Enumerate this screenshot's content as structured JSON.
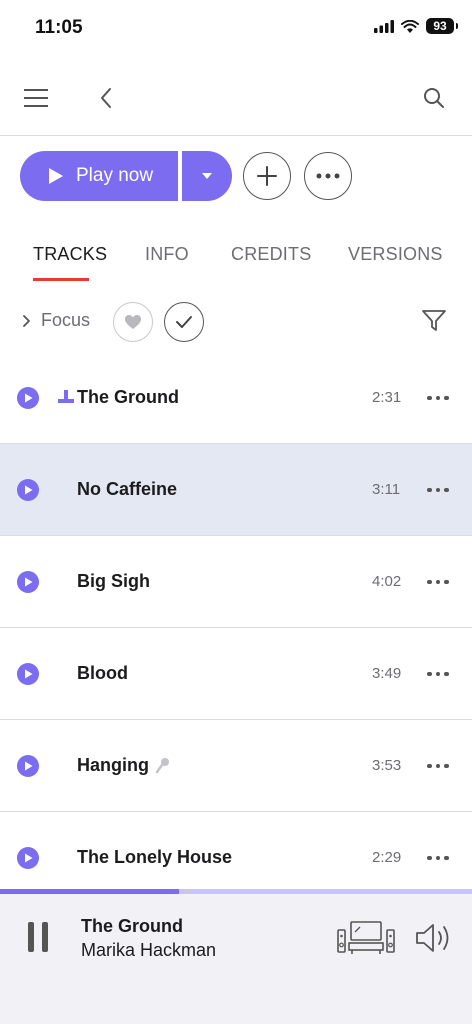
{
  "status_bar": {
    "time": "11:05",
    "battery": "93"
  },
  "nav": {
    "menu_icon": "hamburger-menu-icon",
    "back_icon": "chevron-left-icon",
    "search_icon": "search-icon"
  },
  "actions": {
    "play_label": "Play now",
    "add_icon": "plus-icon",
    "more_icon": "ellipsis-icon"
  },
  "tabs": [
    {
      "label": "TRACKS",
      "active": true
    },
    {
      "label": "INFO",
      "active": false
    },
    {
      "label": "CREDITS",
      "active": false
    },
    {
      "label": "VERSIONS",
      "active": false
    }
  ],
  "focus": {
    "label": "Focus"
  },
  "tracks": [
    {
      "title": "The Ground",
      "duration": "2:31",
      "highlighted": false,
      "now_playing": true
    },
    {
      "title": "No Caffeine",
      "duration": "3:11",
      "highlighted": true,
      "now_playing": false
    },
    {
      "title": "Big Sigh",
      "duration": "4:02",
      "highlighted": false,
      "now_playing": false
    },
    {
      "title": "Blood",
      "duration": "3:49",
      "highlighted": false,
      "now_playing": false
    },
    {
      "title": "Hanging",
      "duration": "3:53",
      "highlighted": false,
      "now_playing": false,
      "has_extra_icon": true
    },
    {
      "title": "The Lonely House",
      "duration": "2:29",
      "highlighted": false,
      "now_playing": false
    }
  ],
  "playback": {
    "progress": 0.38
  },
  "now_playing": {
    "title": "The Ground",
    "artist": "Marika Hackman"
  },
  "colors": {
    "accent": "#7b6cf0",
    "tab_underline": "#e63b2e",
    "highlight_row": "#e3e8f3",
    "player_bg": "#f2f2f6"
  }
}
